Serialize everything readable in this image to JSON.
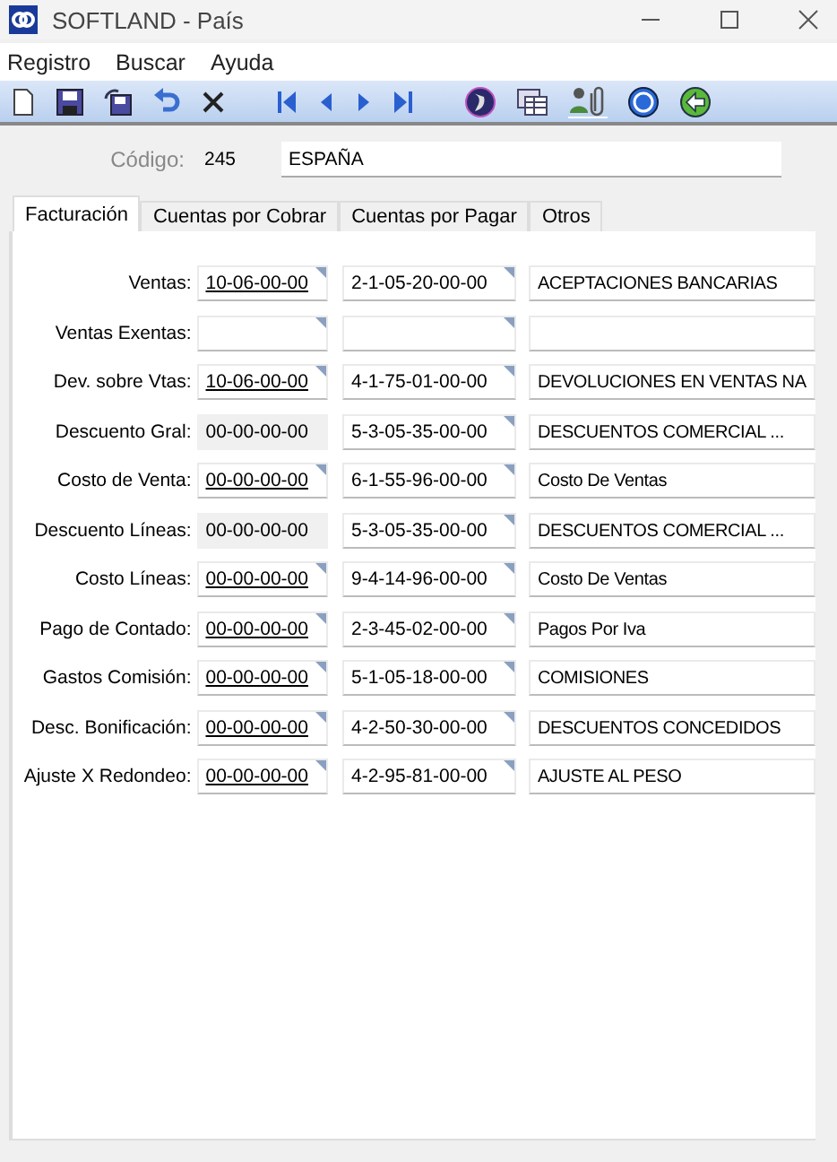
{
  "window": {
    "title": "SOFTLAND - País"
  },
  "menu": [
    "Registro",
    "Buscar",
    "Ayuda"
  ],
  "codigo": {
    "label": "Código:",
    "value": "245",
    "name": "ESPAÑA"
  },
  "tabs": [
    {
      "label": "Facturación",
      "selected": true
    },
    {
      "label": "Cuentas por Cobrar",
      "selected": false
    },
    {
      "label": "Cuentas por Pagar",
      "selected": false
    },
    {
      "label": "Otros",
      "selected": false
    }
  ],
  "rows": [
    {
      "label": "Ventas:",
      "code": "10-06-00-00",
      "code_disabled": false,
      "account": "2-1-05-20-00-00",
      "description": "ACEPTACIONES BANCARIAS"
    },
    {
      "label": "Ventas Exentas:",
      "code_disabled": false
    },
    {
      "label": "Dev. sobre Vtas:",
      "code": "10-06-00-00",
      "code_disabled": false,
      "account": "4-1-75-01-00-00",
      "description": "DEVOLUCIONES EN VENTAS NA"
    },
    {
      "label": "Descuento Gral:",
      "code": "00-00-00-00",
      "code_disabled": true,
      "account": "5-3-05-35-00-00",
      "description": "DESCUENTOS COMERCIAL ..."
    },
    {
      "label": "Costo de Venta:",
      "code": "00-00-00-00",
      "code_disabled": false,
      "account": "6-1-55-96-00-00",
      "description": "Costo De Ventas"
    },
    {
      "label": "Descuento Líneas:",
      "code": "00-00-00-00",
      "code_disabled": true,
      "account": "5-3-05-35-00-00",
      "description": "DESCUENTOS COMERCIAL ..."
    },
    {
      "label": "Costo Líneas:",
      "code": "00-00-00-00",
      "code_disabled": false,
      "account": "9-4-14-96-00-00",
      "description": "Costo De Ventas"
    },
    {
      "label": "Pago de Contado:",
      "code": "00-00-00-00",
      "code_disabled": false,
      "account": "2-3-45-02-00-00",
      "description": "Pagos Por Iva"
    },
    {
      "label": "Gastos Comisión:",
      "code": "00-00-00-00",
      "code_disabled": false,
      "account": "5-1-05-18-00-00",
      "description": "COMISIONES"
    },
    {
      "label": "Desc. Bonificación:",
      "code": "00-00-00-00",
      "code_disabled": false,
      "account": "4-2-50-30-00-00",
      "description": "DESCUENTOS CONCEDIDOS"
    },
    {
      "label": "Ajuste X Redondeo:",
      "code": "00-00-00-00",
      "code_disabled": false,
      "account": "4-2-95-81-00-00",
      "description": "AJUSTE AL PESO"
    }
  ]
}
